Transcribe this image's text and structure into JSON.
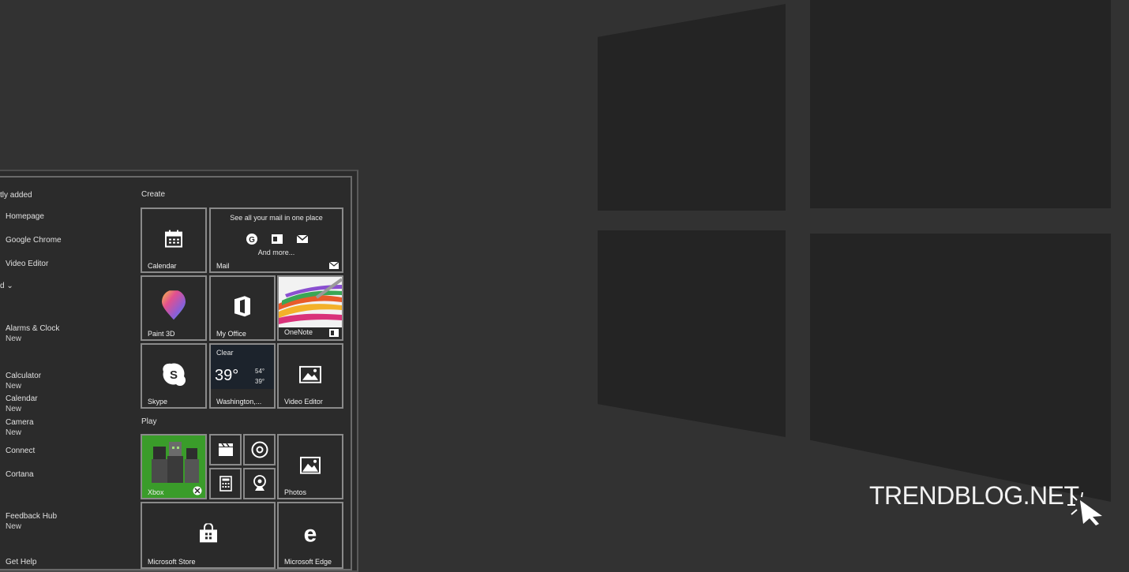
{
  "start_menu": {
    "recently_added_label": "tly added",
    "left_list": [
      {
        "name": "Homepage"
      },
      {
        "name": "Google Chrome"
      },
      {
        "name": "Video Editor"
      }
    ],
    "section_toggle": "d ⌄",
    "apps": [
      {
        "name": "Alarms & Clock",
        "badge": "New"
      },
      {
        "name": "Calculator",
        "badge": "New"
      },
      {
        "name": "Calendar",
        "badge": "New"
      },
      {
        "name": "Camera",
        "badge": "New"
      },
      {
        "name": "Connect",
        "badge": ""
      },
      {
        "name": "Cortana",
        "badge": ""
      },
      {
        "name": "Feedback Hub",
        "badge": "New"
      },
      {
        "name": "Get Help",
        "badge": ""
      }
    ],
    "groups": {
      "create": "Create",
      "play": "Play"
    },
    "tiles": {
      "calendar": "Calendar",
      "mail": "Mail",
      "mail_header": "See all your mail in one place",
      "mail_more": "And more...",
      "paint3d": "Paint 3D",
      "my_office": "My Office",
      "onenote": "OneNote",
      "skype": "Skype",
      "weather_label": "Washington,...",
      "weather_condition": "Clear",
      "weather_temp": "39°",
      "weather_high": "54°",
      "weather_low": "39°",
      "video_editor": "Video Editor",
      "xbox": "Xbox",
      "photos": "Photos",
      "store": "Microsoft Store",
      "edge": "Microsoft Edge"
    }
  },
  "watermark": "TRENDBLOG.NET",
  "colors": {
    "background": "#323232",
    "logo": "#242424",
    "xbox_green": "#3a9c2a"
  }
}
